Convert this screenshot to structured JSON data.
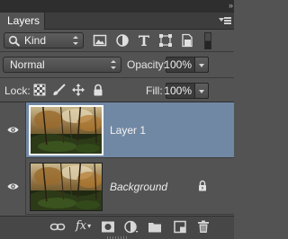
{
  "panel": {
    "tab_label": "Layers",
    "collapse_glyph": "»",
    "menu_icon": "panel-menu-icon"
  },
  "filter": {
    "kind_label": "Kind",
    "icons": [
      "pixel-filter-icon",
      "adjustment-filter-icon",
      "type-filter-icon",
      "shape-filter-icon",
      "smart-object-filter-icon"
    ],
    "toggle_icon": "filter-toggle-icon"
  },
  "blend": {
    "mode": "Normal",
    "opacity_label": "Opacity:",
    "opacity_value": "100%"
  },
  "lock": {
    "label": "Lock:",
    "icons": [
      "lock-transparent-pixels-icon",
      "lock-image-pixels-icon",
      "lock-position-icon",
      "lock-all-icon"
    ],
    "fill_label": "Fill:",
    "fill_value": "100%"
  },
  "layers": [
    {
      "name": "Layer 1",
      "selected": true,
      "visible": true,
      "locked": false
    },
    {
      "name": "Background",
      "selected": false,
      "visible": true,
      "locked": true
    }
  ],
  "bottom_bar": {
    "fx_label": "fx",
    "icons": [
      "link-layers-icon",
      "fx-icon",
      "add-mask-icon",
      "adjustment-layer-icon",
      "new-group-icon",
      "new-layer-icon",
      "trash-icon"
    ]
  },
  "colors": {
    "panel_bg": "#535353",
    "selection": "#7188a4",
    "text": "#e6e6e6"
  }
}
